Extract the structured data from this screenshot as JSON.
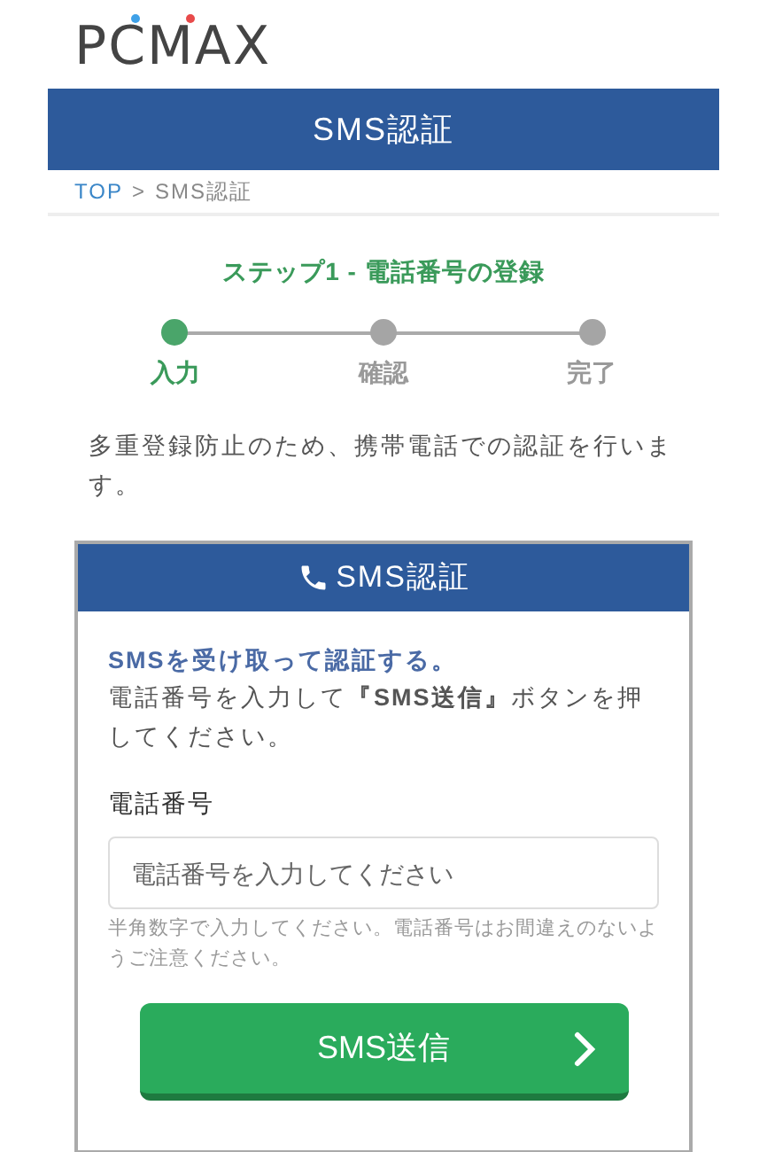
{
  "logo": "PCMAX",
  "header": {
    "title": "SMS認証"
  },
  "breadcrumb": [
    {
      "label": "TOP"
    },
    {
      "label": ">"
    },
    {
      "label": "SMS認証"
    }
  ],
  "step_title": "ステップ1 - 電話番号の登録",
  "steps": [
    {
      "label": "入力",
      "selected": true
    },
    {
      "label": "確認",
      "selected": false
    },
    {
      "label": "完了",
      "selected": false
    }
  ],
  "notice": "多重登録防止のため、携帯電話での認証を行います。",
  "card": {
    "title": "SMS認証",
    "lead": "SMSを受け取って認証する。",
    "instruction": "電話番号を入力して**『SMS送信』**ボタンを押してください。",
    "field_label": "電話番号",
    "placeholder": "電話番号を入力してください",
    "hint": "半角数字で入力してください。電話番号はお間違えのないようご注意ください。",
    "button": "SMS送信"
  }
}
